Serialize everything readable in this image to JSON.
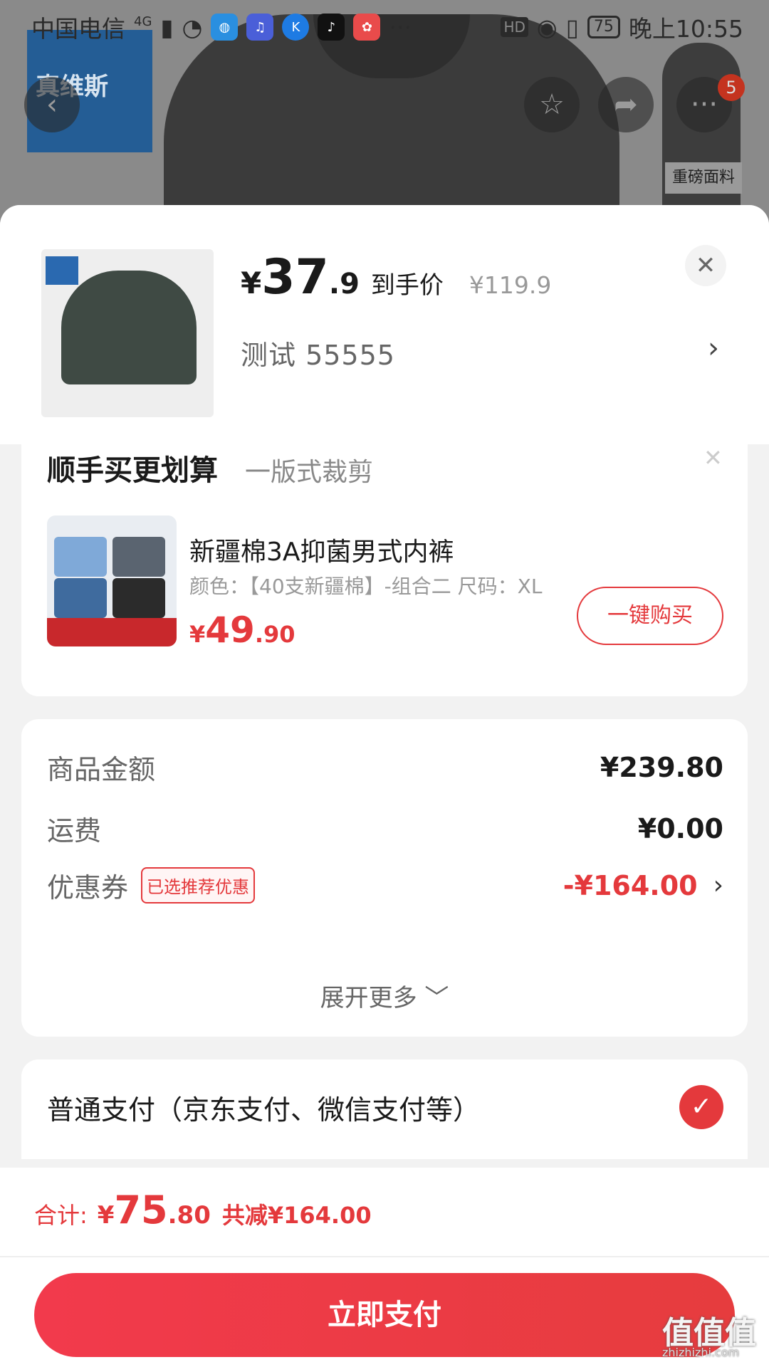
{
  "status_bar": {
    "carrier": "中国电信",
    "network": "4G",
    "more": "···",
    "hd": "HD",
    "battery": "75",
    "time": "晚上10:55"
  },
  "background_page": {
    "brand_text": "真维斯",
    "tag_label": "重磅面料",
    "cart_badge": "5"
  },
  "product": {
    "price_symbol": "¥",
    "price_int": "37",
    "price_dec": ".9",
    "price_label": "到手价",
    "original_price": "¥119.9",
    "spec": "测试  55555"
  },
  "upsell": {
    "title": "顺手买更划算",
    "subtitle": "一版式裁剪",
    "item_name": "新疆棉3A抑菌男式内裤",
    "item_spec": "颜色：【40支新疆棉】-组合二   尺码：XL",
    "price_symbol": "¥",
    "price_int": "49",
    "price_dec": ".90",
    "buy_label": "一键购买"
  },
  "summary": {
    "goods_label": "商品金额",
    "goods_value": "¥239.80",
    "shipping_label": "运费",
    "shipping_value": "¥0.00",
    "coupon_label": "优惠券",
    "coupon_tag": "已选推荐优惠",
    "coupon_value": "-¥164.00",
    "expand_label": "展开更多 ﹀"
  },
  "payment": {
    "method_label": "普通支付（京东支付、微信支付等）"
  },
  "footer": {
    "total_label": "合计:",
    "total_symbol": "¥",
    "total_int": "75",
    "total_dec": ".80",
    "saved": "共减¥164.00",
    "pay_button": "立即支付"
  },
  "watermark": {
    "text": "值值值",
    "domain": "zhizhizhi.com"
  },
  "colors": {
    "accent": "#e4393c",
    "pay_button": "#f23a4c"
  }
}
